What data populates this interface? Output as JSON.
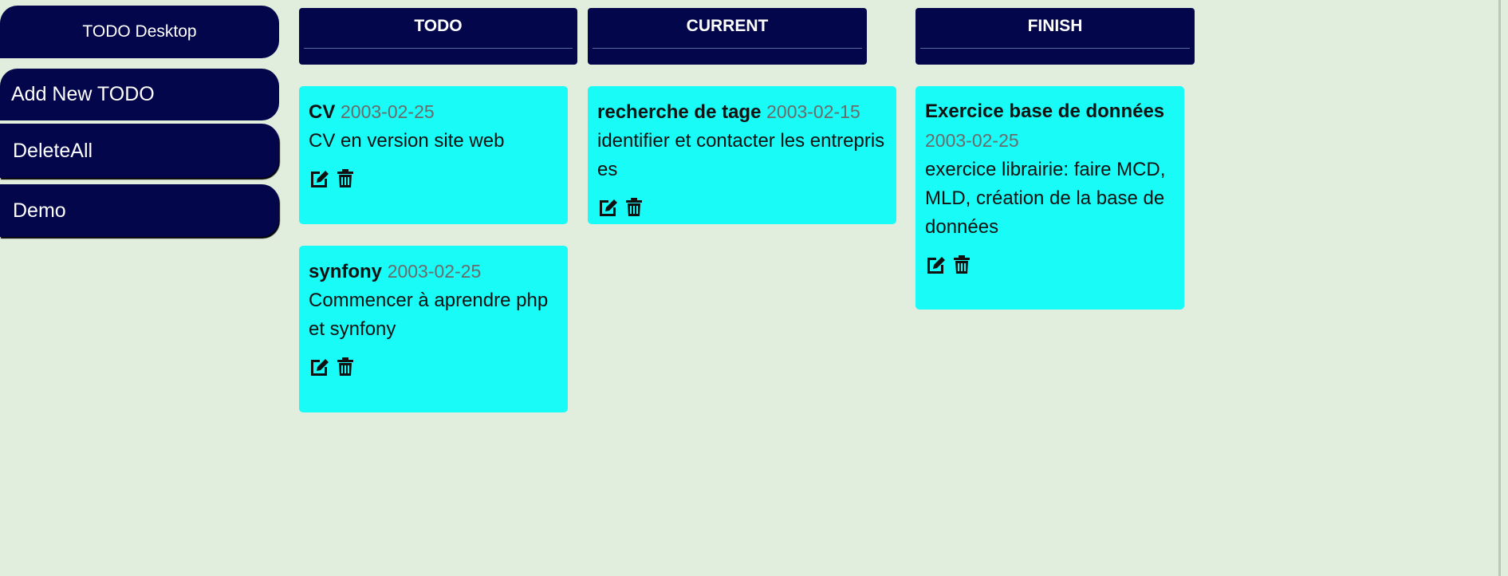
{
  "sidebar": {
    "title": "TODO Desktop",
    "add_label": "Add New TODO",
    "delete_all_label": "DeleteAll",
    "demo_label": "Demo"
  },
  "columns": [
    {
      "title": "TODO",
      "cards": [
        {
          "title": "CV",
          "date": "2003-02-25",
          "description": "CV en version site web"
        },
        {
          "title": "synfony",
          "date": "2003-02-25",
          "description": "Commencer à aprendre php et synfony"
        }
      ]
    },
    {
      "title": "CURRENT",
      "cards": [
        {
          "title": "recherche de tage",
          "date": "2003-02-15",
          "description": "identifier et contacter les entreprises"
        }
      ]
    },
    {
      "title": "FINISH",
      "cards": [
        {
          "title": "Exercice base de données",
          "date": "2003-02-25",
          "description": "exercice librairie: faire MCD, MLD, création de la base de données"
        }
      ]
    }
  ],
  "icons": {
    "edit": "edit-icon",
    "delete": "trash-icon"
  },
  "colors": {
    "background": "#e1eedd",
    "nav": "#03064a",
    "card": "#18fbf6",
    "date": "#6b6b6b"
  }
}
